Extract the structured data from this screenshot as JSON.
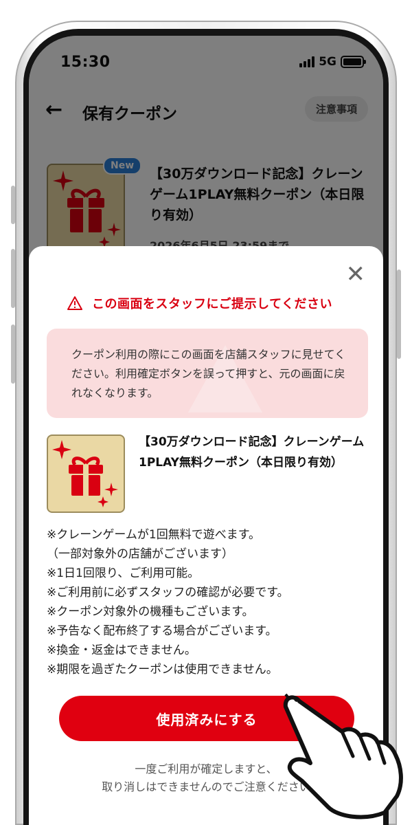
{
  "status_bar": {
    "time": "15:30",
    "network": "5G"
  },
  "nav": {
    "back_icon": "arrow-left-icon",
    "title": "保有クーポン",
    "notes_label": "注意事項"
  },
  "list_coupon": {
    "badge": "New",
    "title": "【30万ダウンロード記念】クレーンゲーム1PLAY無料クーポン（本日限り有効）",
    "expiry": "2026年6月5日 23:59まで"
  },
  "sheet": {
    "close_icon": "close-icon",
    "warning_text": "この画面をスタッフにご提示してください",
    "notice_text": "クーポン利用の際にこの画面を店舗スタッフに見せてください。利用確定ボタンを誤って押すと、元の画面に戻れなくなります。",
    "coupon_title": "【30万ダウンロード記念】クレーンゲーム1PLAY無料クーポン（本日限り有効）",
    "terms": [
      "※クレーンゲームが1回無料で遊べます。",
      "（一部対象外の店舗がございます）",
      "※1日1回限り、ご利用可能。",
      "※ご利用前に必ずスタッフの確認が必要です。",
      "※クーポン対象外の機種もございます。",
      "※予告なく配布終了する場合がございます。",
      "※換金・返金はできません。",
      "※期限を過ぎたクーポンは使用できません。"
    ],
    "use_button": "使用済みにする",
    "confirm_line1": "一度ご利用が確定しますと、",
    "confirm_line2": "取り消しはできませんのでご注意ください"
  },
  "colors": {
    "accent_red": "#e00010",
    "warning_red": "#d90011",
    "notice_bg": "#fadcdd",
    "coupon_bg": "#ead8a4",
    "new_badge": "#2a7fd6"
  }
}
